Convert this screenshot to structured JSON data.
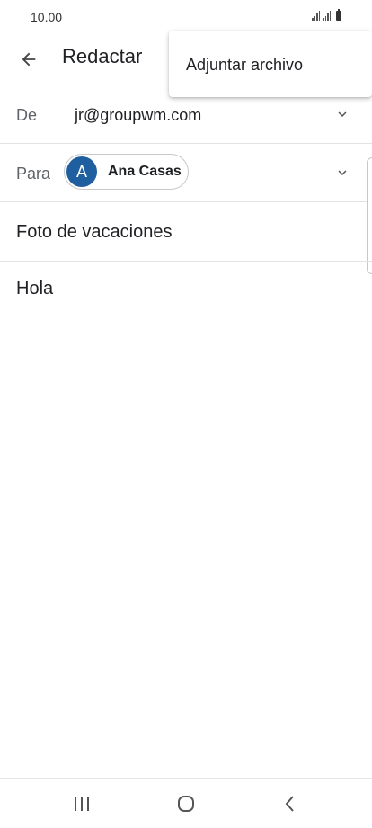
{
  "status_bar": {
    "time": "10.00",
    "icons": [
      "signal-icon",
      "signal-icon",
      "battery-icon"
    ]
  },
  "app_bar": {
    "title": "Redactar",
    "back_icon": "arrow-back-icon"
  },
  "overflow_menu": {
    "items": [
      {
        "label": "Adjuntar archivo"
      }
    ]
  },
  "compose": {
    "from": {
      "label": "De",
      "value": "jr@groupwm.com"
    },
    "to": {
      "label": "Para",
      "recipient": {
        "initial": "A",
        "name": "Ana Casas",
        "avatar_color": "#1f5fa0"
      }
    },
    "subject": "Foto de vacaciones",
    "body": "Hola"
  },
  "nav_bar": {
    "buttons": [
      "recent-apps-icon",
      "home-icon",
      "back-icon"
    ]
  }
}
